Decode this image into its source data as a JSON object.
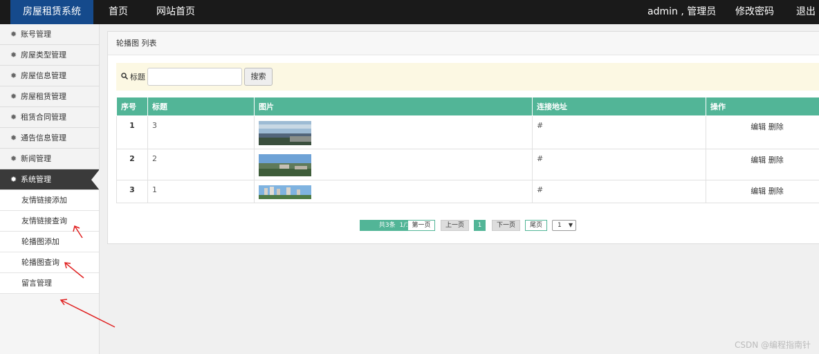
{
  "header": {
    "brand": "房屋租赁系统",
    "nav": [
      "首页",
      "网站首页"
    ],
    "user": "admin , 管理员",
    "change_password": "修改密码",
    "logout": "退出"
  },
  "sidebar": {
    "items": [
      "账号管理",
      "房屋类型管理",
      "房屋信息管理",
      "房屋租赁管理",
      "租赁合同管理",
      "通告信息管理",
      "新闻管理",
      "系统管理"
    ],
    "sub_items": [
      "友情链接添加",
      "友情链接查询",
      "轮播图添加",
      "轮播图查询",
      "留言管理"
    ],
    "active": "系统管理"
  },
  "panel": {
    "title": "轮播图 列表",
    "search": {
      "label": "标题",
      "value": "",
      "button": "搜索"
    }
  },
  "table": {
    "headers": [
      "序号",
      "标题",
      "图片",
      "连接地址",
      "操作"
    ],
    "rows": [
      {
        "idx": "1",
        "title": "3",
        "link": "#",
        "edit": "编辑",
        "del": "删除"
      },
      {
        "idx": "2",
        "title": "2",
        "link": "#",
        "edit": "编辑",
        "del": "删除"
      },
      {
        "idx": "3",
        "title": "1",
        "link": "#",
        "edit": "编辑",
        "del": "删除"
      }
    ]
  },
  "pagination": {
    "total": "共3条",
    "pages": "1/1页",
    "first": "第一页",
    "prev": "上一页",
    "current": "1",
    "next": "下一页",
    "last": "尾页",
    "select": "1"
  },
  "watermark": "CSDN @编程指南针",
  "colors": {
    "accent": "#52b597",
    "brand_bg": "#154a8c",
    "topbar": "#1a1a1a",
    "arrow": "#e02020"
  }
}
